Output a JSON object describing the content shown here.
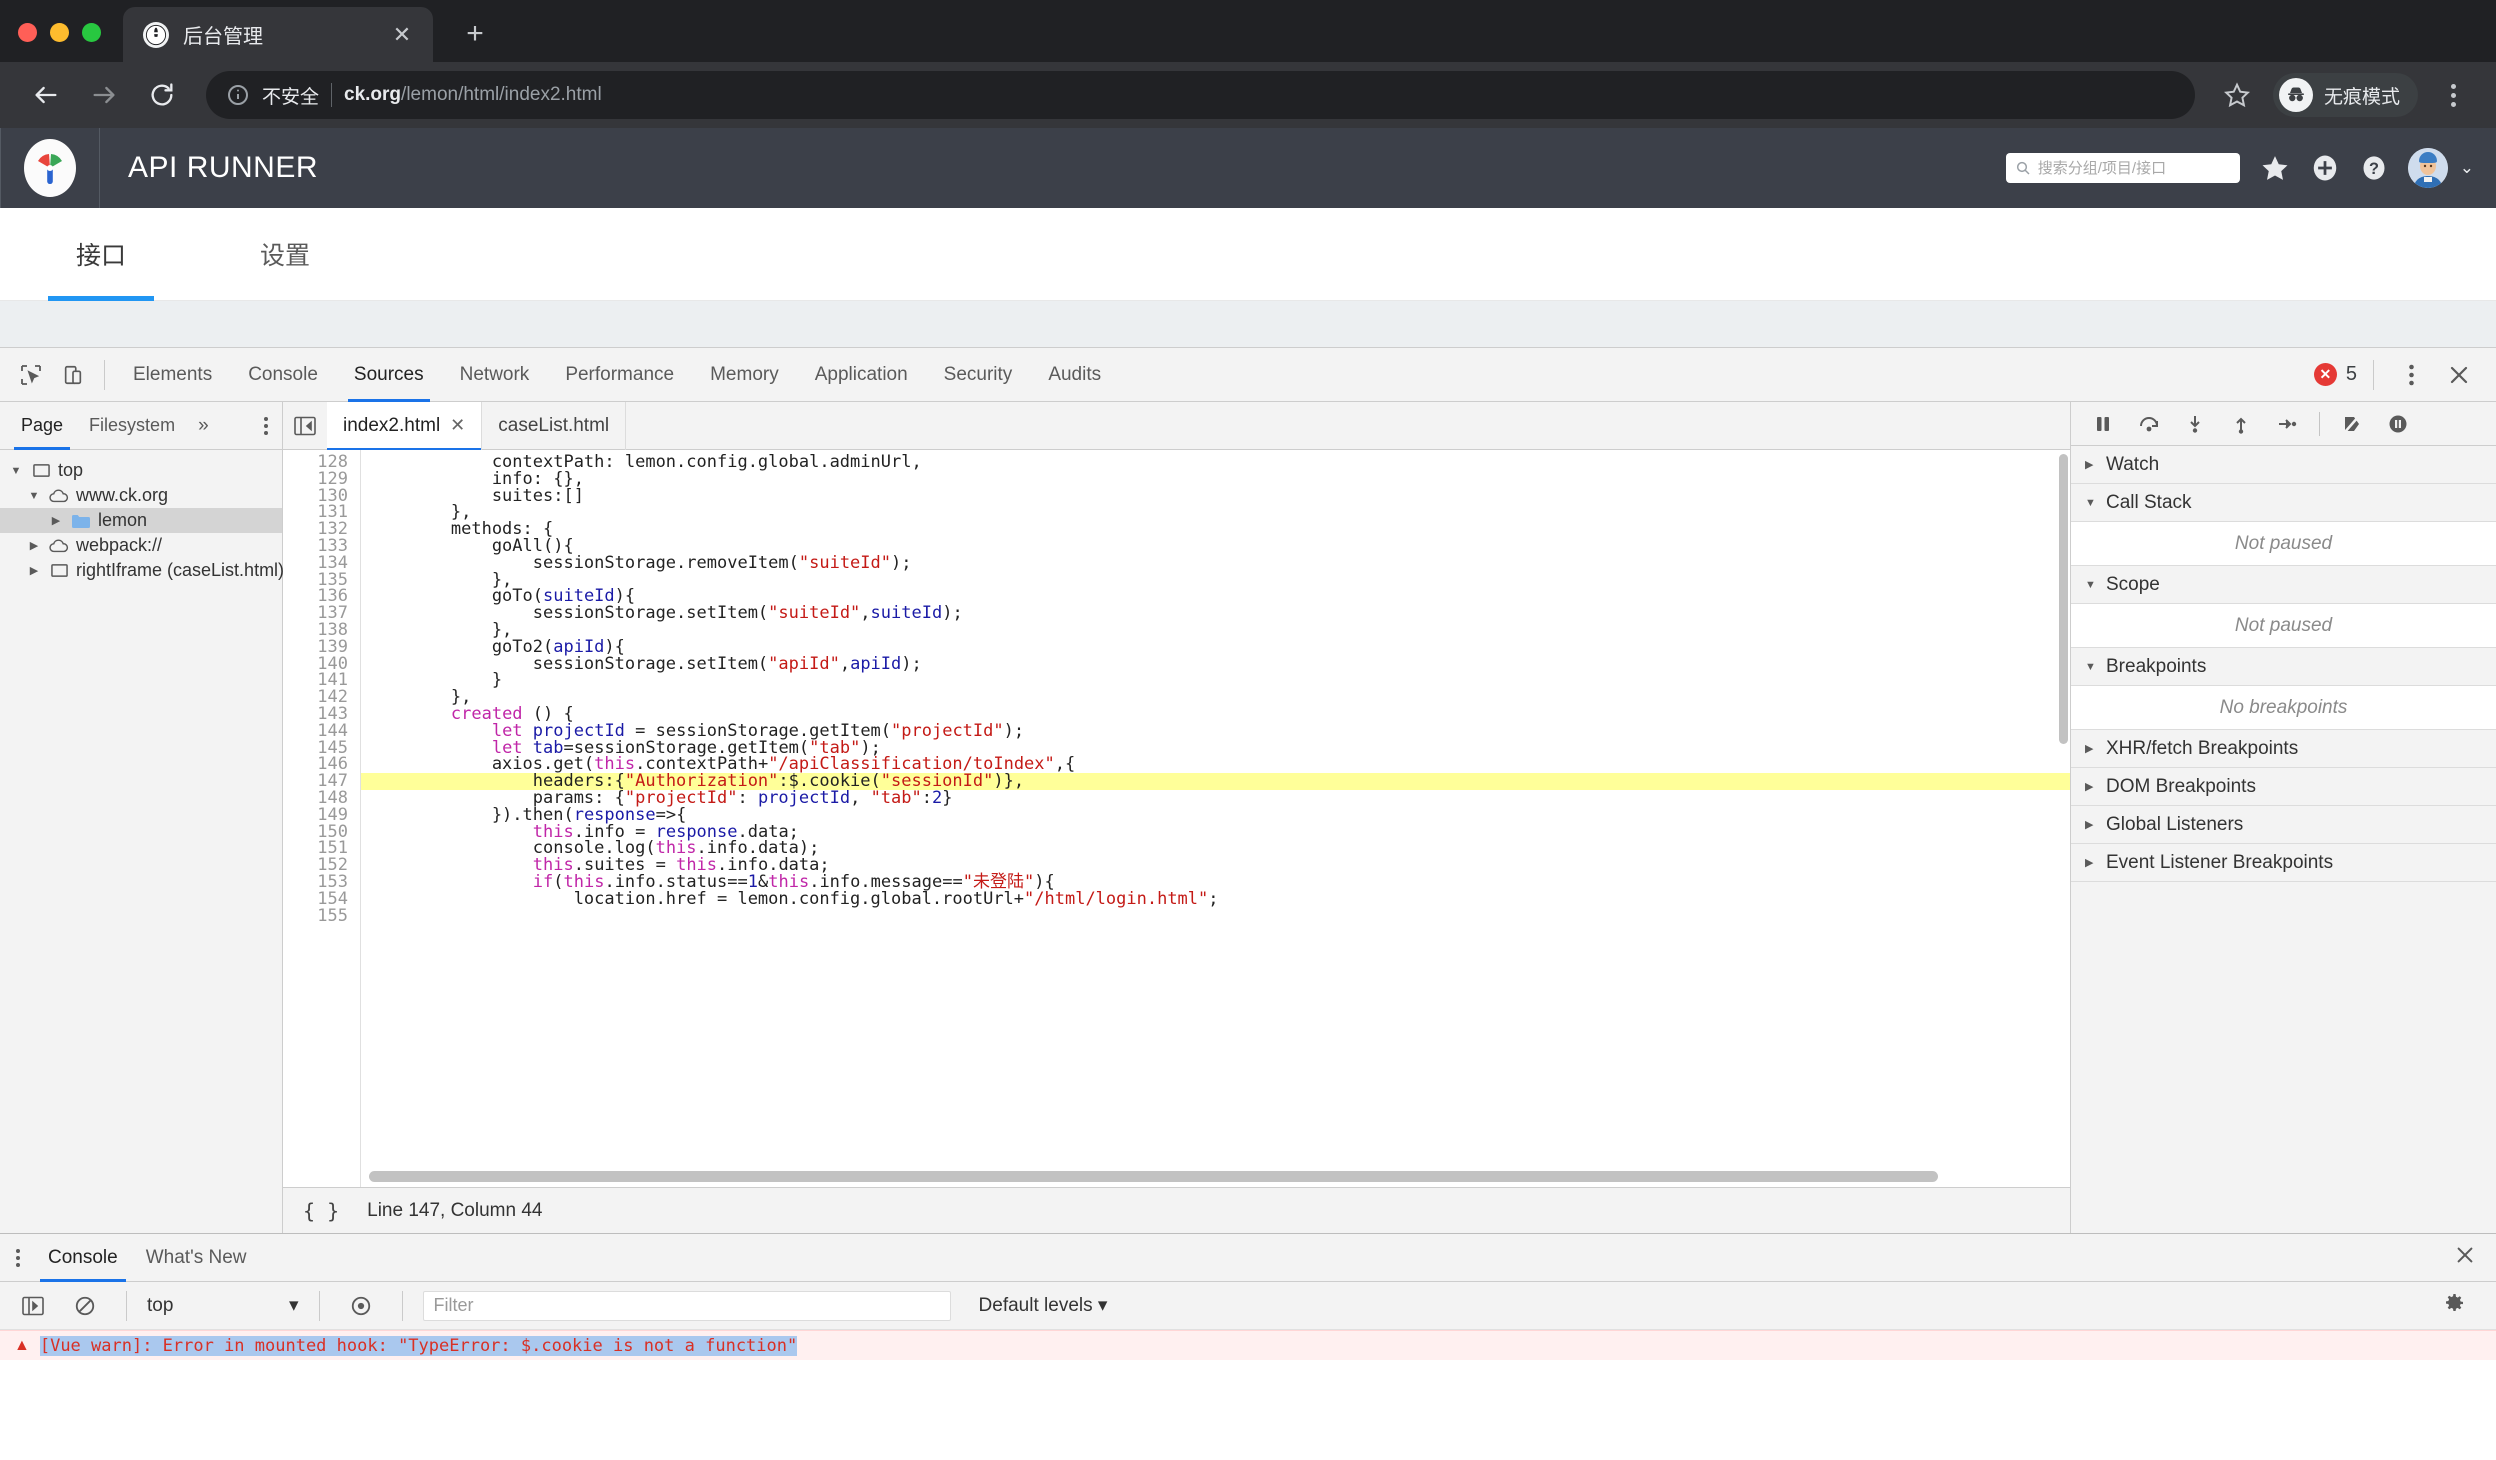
{
  "browser": {
    "tab": {
      "title": "后台管理",
      "favicon": "globe-icon",
      "close": "✕"
    },
    "new_tab": "+",
    "omnibox": {
      "security_label": "不安全",
      "url_domain": "ck.org",
      "url_path": "/lemon/html/index2.html"
    },
    "incognito_label": "无痕模式"
  },
  "app": {
    "title": "API RUNNER",
    "search": {
      "placeholder": "搜索分组/项目/接口",
      "value": ""
    },
    "tabs": [
      {
        "label": "接口",
        "active": true
      },
      {
        "label": "设置",
        "active": false
      }
    ]
  },
  "devtools": {
    "tabs": [
      {
        "label": "Elements"
      },
      {
        "label": "Console"
      },
      {
        "label": "Sources"
      },
      {
        "label": "Network"
      },
      {
        "label": "Performance"
      },
      {
        "label": "Memory"
      },
      {
        "label": "Application"
      },
      {
        "label": "Security"
      },
      {
        "label": "Audits"
      }
    ],
    "active_tab": "Sources",
    "error_count": "5",
    "navigator": {
      "tabs": [
        {
          "label": "Page"
        },
        {
          "label": "Filesystem"
        }
      ],
      "active_tab": "Page",
      "more": "»",
      "tree": [
        {
          "label": "top",
          "icon": "frame-icon",
          "indent": 0,
          "caret": "▼",
          "selected": false
        },
        {
          "label": "www.ck.org",
          "icon": "cloud-icon",
          "indent": 1,
          "caret": "▼",
          "selected": false
        },
        {
          "label": "lemon",
          "icon": "folder-icon",
          "indent": 2,
          "caret": "▶",
          "selected": true
        },
        {
          "label": "webpack://",
          "icon": "cloud-icon",
          "indent": 1,
          "caret": "▶",
          "selected": false
        },
        {
          "label": "rightIframe (caseList.html)",
          "icon": "frame-icon",
          "indent": 1,
          "caret": "▶",
          "selected": false
        }
      ]
    },
    "editor": {
      "tabs": [
        {
          "label": "index2.html",
          "active": true,
          "closable": true
        },
        {
          "label": "caseList.html",
          "active": false,
          "closable": false
        }
      ],
      "status": "Line 147, Column 44",
      "pretty_print": "{ }",
      "first_line": 128,
      "highlight_line": 147,
      "lines": [
        "            contextPath: lemon.config.global.adminUrl,",
        "            info: {},",
        "            suites:[]",
        "        },",
        "        methods: {",
        "            goAll(){",
        "                sessionStorage.removeItem(\"suiteId\");",
        "            },",
        "            goTo(suiteId){",
        "                sessionStorage.setItem(\"suiteId\",suiteId);",
        "            },",
        "            goTo2(apiId){",
        "                sessionStorage.setItem(\"apiId\",apiId);",
        "            }",
        "        },",
        "        created () {",
        "            let projectId = sessionStorage.getItem(\"projectId\");",
        "            let tab=sessionStorage.getItem(\"tab\");",
        "            axios.get(this.contextPath+\"/apiClassification/toIndex\",{",
        "                headers:{\"Authorization\":$.cookie(\"sessionId\")},",
        "                params: {\"projectId\": projectId, \"tab\":2}",
        "            }).then(response=>{",
        "                this.info = response.data;",
        "                console.log(this.info.data);",
        "                this.suites = this.info.data;",
        "                if(this.info.status==1&this.info.message==\"未登陆\"){",
        "                    location.href = lemon.config.global.rootUrl+\"/html/login.html\";",
        ""
      ]
    },
    "debugger": {
      "sections": [
        {
          "label": "Watch",
          "caret": "▶",
          "empty": null
        },
        {
          "label": "Call Stack",
          "caret": "▼",
          "empty": "Not paused"
        },
        {
          "label": "Scope",
          "caret": "▼",
          "empty": "Not paused"
        },
        {
          "label": "Breakpoints",
          "caret": "▼",
          "empty": "No breakpoints"
        },
        {
          "label": "XHR/fetch Breakpoints",
          "caret": "▶",
          "empty": null
        },
        {
          "label": "DOM Breakpoints",
          "caret": "▶",
          "empty": null
        },
        {
          "label": "Global Listeners",
          "caret": "▶",
          "empty": null
        },
        {
          "label": "Event Listener Breakpoints",
          "caret": "▶",
          "empty": null
        }
      ]
    },
    "drawer": {
      "tabs": [
        {
          "label": "Console",
          "active": true
        },
        {
          "label": "What's New",
          "active": false
        }
      ],
      "context": "top",
      "filter_placeholder": "Filter",
      "levels": "Default levels",
      "message": "[Vue warn]: Error in mounted hook: \"TypeError: $.cookie is not a function\""
    }
  },
  "colors": {
    "accent": "#1a73e8",
    "app_header_bg": "#3c4049",
    "chrome_bg": "#202124",
    "error_red": "#e53935",
    "highlight_yellow": "#ffff99"
  }
}
